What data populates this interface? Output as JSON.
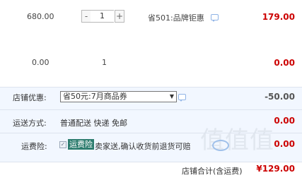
{
  "row1": {
    "unit_price": "680.00",
    "qty_minus": "-",
    "qty_value": "1",
    "qty_plus": "+",
    "promo": "省501:品牌钜惠",
    "subtotal": "179.00"
  },
  "row2": {
    "unit_price": "0.00",
    "qty": "1",
    "subtotal": "0.00"
  },
  "shop_discount": {
    "label": "店铺优惠:",
    "selected": "省50元:7月商品券",
    "amount": "-50.00"
  },
  "shipping": {
    "label": "运送方式:",
    "value": "普通配送 快递 免邮",
    "amount": "0.00"
  },
  "insurance": {
    "label": "运费险:",
    "checkbox_mark": "✓",
    "tag": "运费险",
    "text": "卖家送,确认收货前退货可赔",
    "amount": "0.00"
  },
  "total": {
    "label": "店铺合计(含运费)",
    "currency": "¥",
    "amount": "129.00"
  },
  "watermark": "值值值",
  "colors": {
    "price_red": "#cc0000",
    "panel_bg": "#f2f7ff",
    "tag_bg": "#2e7d6f"
  }
}
